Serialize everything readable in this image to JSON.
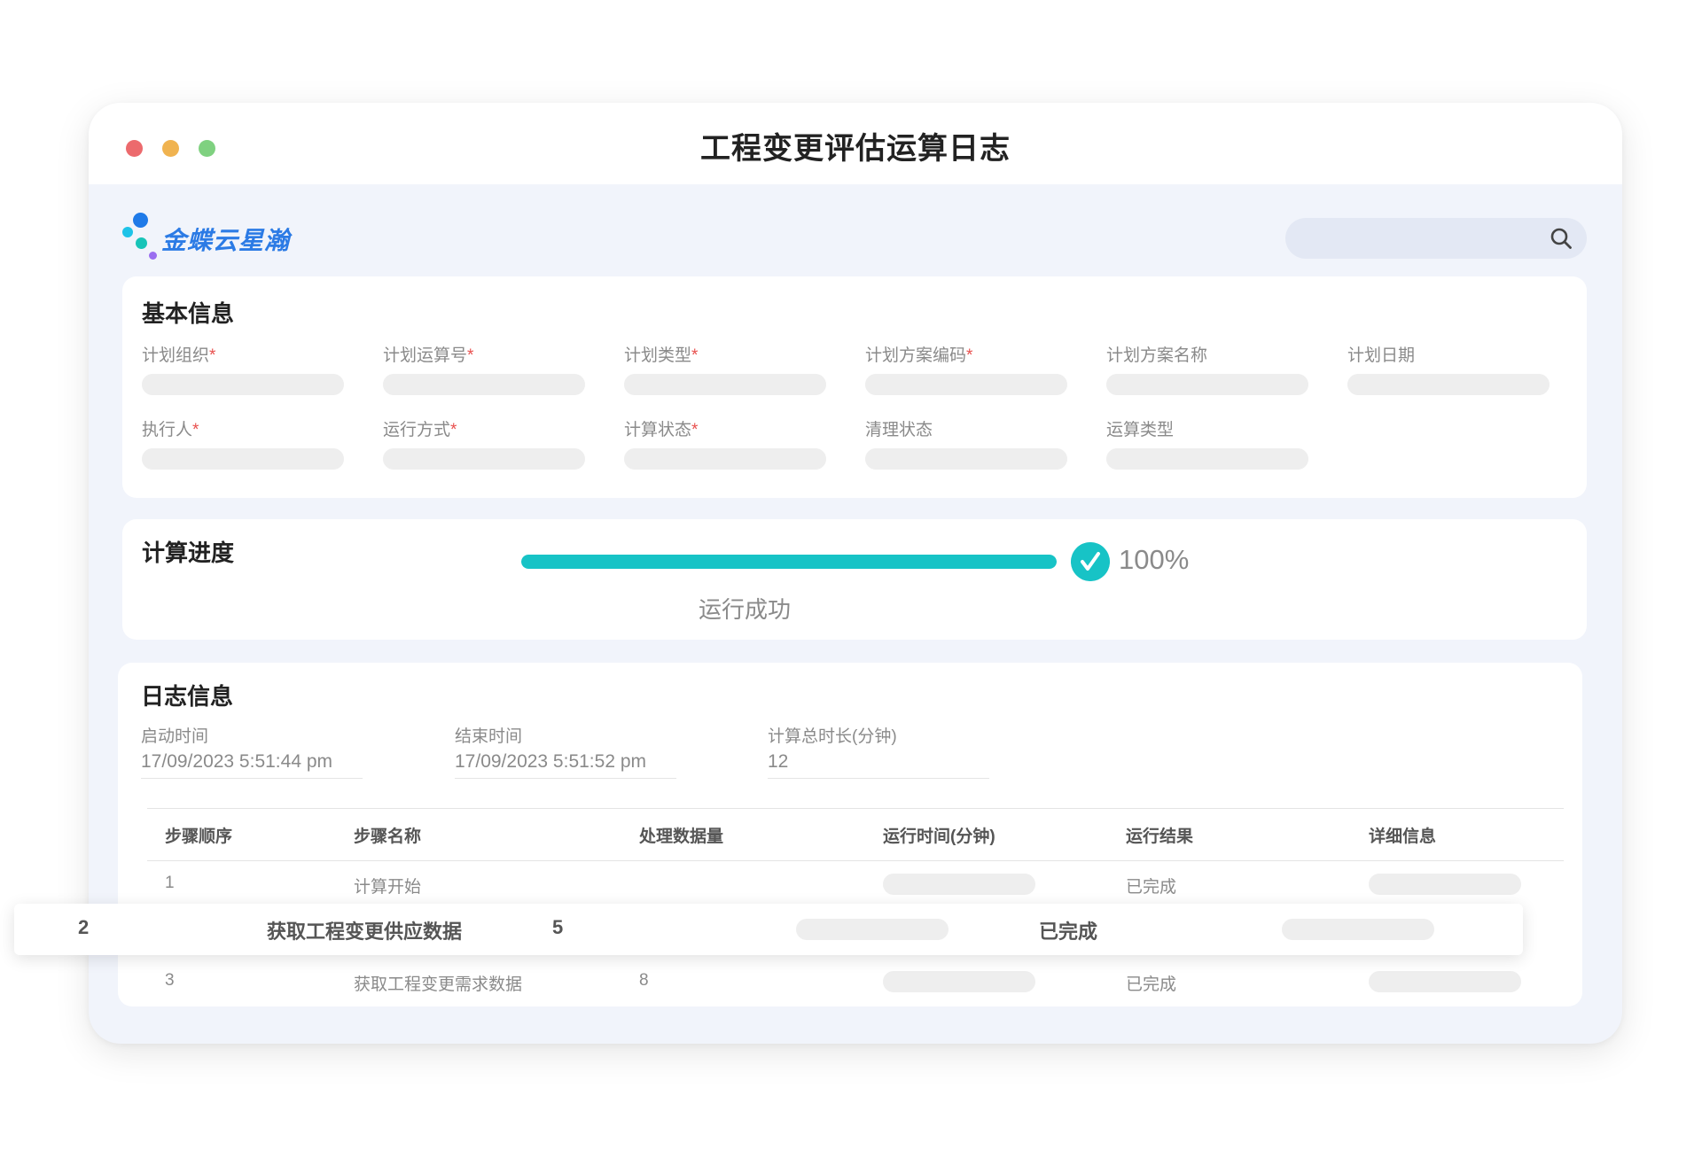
{
  "window": {
    "title": "工程变更评估运算日志"
  },
  "brand": {
    "name": "金蝶云星瀚"
  },
  "search": {
    "placeholder": ""
  },
  "basic": {
    "title": "基本信息",
    "fields": [
      {
        "label": "计划组织",
        "required": "*"
      },
      {
        "label": "计划运算号",
        "required": "*"
      },
      {
        "label": "计划类型",
        "required": "*"
      },
      {
        "label": "计划方案编码",
        "required": "*"
      },
      {
        "label": "计划方案名称",
        "required": ""
      },
      {
        "label": "计划日期",
        "required": ""
      },
      {
        "label": "执行人",
        "required": "*"
      },
      {
        "label": "运行方式",
        "required": "*"
      },
      {
        "label": "计算状态",
        "required": "*"
      },
      {
        "label": "清理状态",
        "required": ""
      },
      {
        "label": "运算类型",
        "required": ""
      }
    ]
  },
  "progress": {
    "title": "计算进度",
    "value": 100,
    "percent_text": "100%",
    "status": "运行成功",
    "color": "#17c3c6"
  },
  "log": {
    "title": "日志信息",
    "start_label": "启动时间",
    "start_value": "17/09/2023 5:51:44 pm",
    "end_label": "结束时间",
    "end_value": "17/09/2023 5:51:52 pm",
    "duration_label": "计算总时长(分钟)",
    "duration_value": "12",
    "columns": [
      "步骤顺序",
      "步骤名称",
      "处理数据量",
      "运行时间(分钟)",
      "运行结果",
      "详细信息"
    ],
    "rows": [
      {
        "order": "1",
        "name": "计算开始",
        "count": "",
        "result": "已完成"
      },
      {
        "order": "2",
        "name": "获取工程变更供应数据",
        "count": "5",
        "result": "已完成"
      },
      {
        "order": "3",
        "name": "获取工程变更需求数据",
        "count": "8",
        "result": "已完成"
      }
    ]
  }
}
